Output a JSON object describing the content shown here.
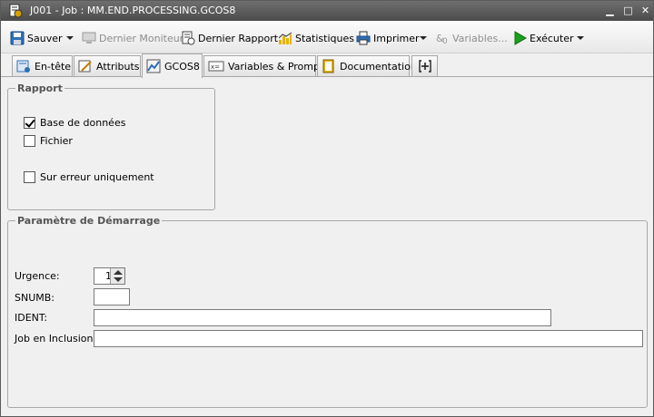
{
  "window": {
    "title": "J001 - Job : MM.END.PROCESSING.GCOS8",
    "controls": [
      "minimize-icon",
      "maximize-icon",
      "close-icon"
    ]
  },
  "toolbar": {
    "save": "Sauver",
    "last_monitor": "Dernier Moniteur",
    "last_report": "Dernier Rapport",
    "statistics": "Statistiques",
    "print": "Imprimer",
    "variables": "Variables...",
    "execute": "Exécuter"
  },
  "tabs": [
    {
      "label": "En-tête",
      "icon": "header-icon"
    },
    {
      "label": "Attributs",
      "icon": "attributes-icon"
    },
    {
      "label": "GCOS8",
      "icon": "gcos8-icon"
    },
    {
      "label": "Variables & Prompts",
      "icon": "variables-icon"
    },
    {
      "label": "Documentation",
      "icon": "documentation-icon"
    },
    {
      "label": "",
      "icon": "add-tab-icon"
    }
  ],
  "active_tab": "GCOS8",
  "rapport": {
    "legend": "Rapport",
    "database": {
      "label": "Base de données",
      "checked": true
    },
    "file": {
      "label": "Fichier",
      "checked": false
    },
    "on_error_only": {
      "label": "Sur erreur uniquement",
      "checked": false
    }
  },
  "startup_params": {
    "legend": "Paramètre de Démarrage",
    "urgency": {
      "label": "Urgence:",
      "value": "1"
    },
    "snumb": {
      "label": "SNUMB:",
      "value": ""
    },
    "ident": {
      "label": "IDENT:",
      "value": ""
    },
    "include_job": {
      "label": "Job en Inclusion:",
      "value": ""
    }
  },
  "colors": {
    "titlebar": "#4b4b4b",
    "execute_green": "#1aa01a",
    "stats_yellow": "#e8b400"
  }
}
